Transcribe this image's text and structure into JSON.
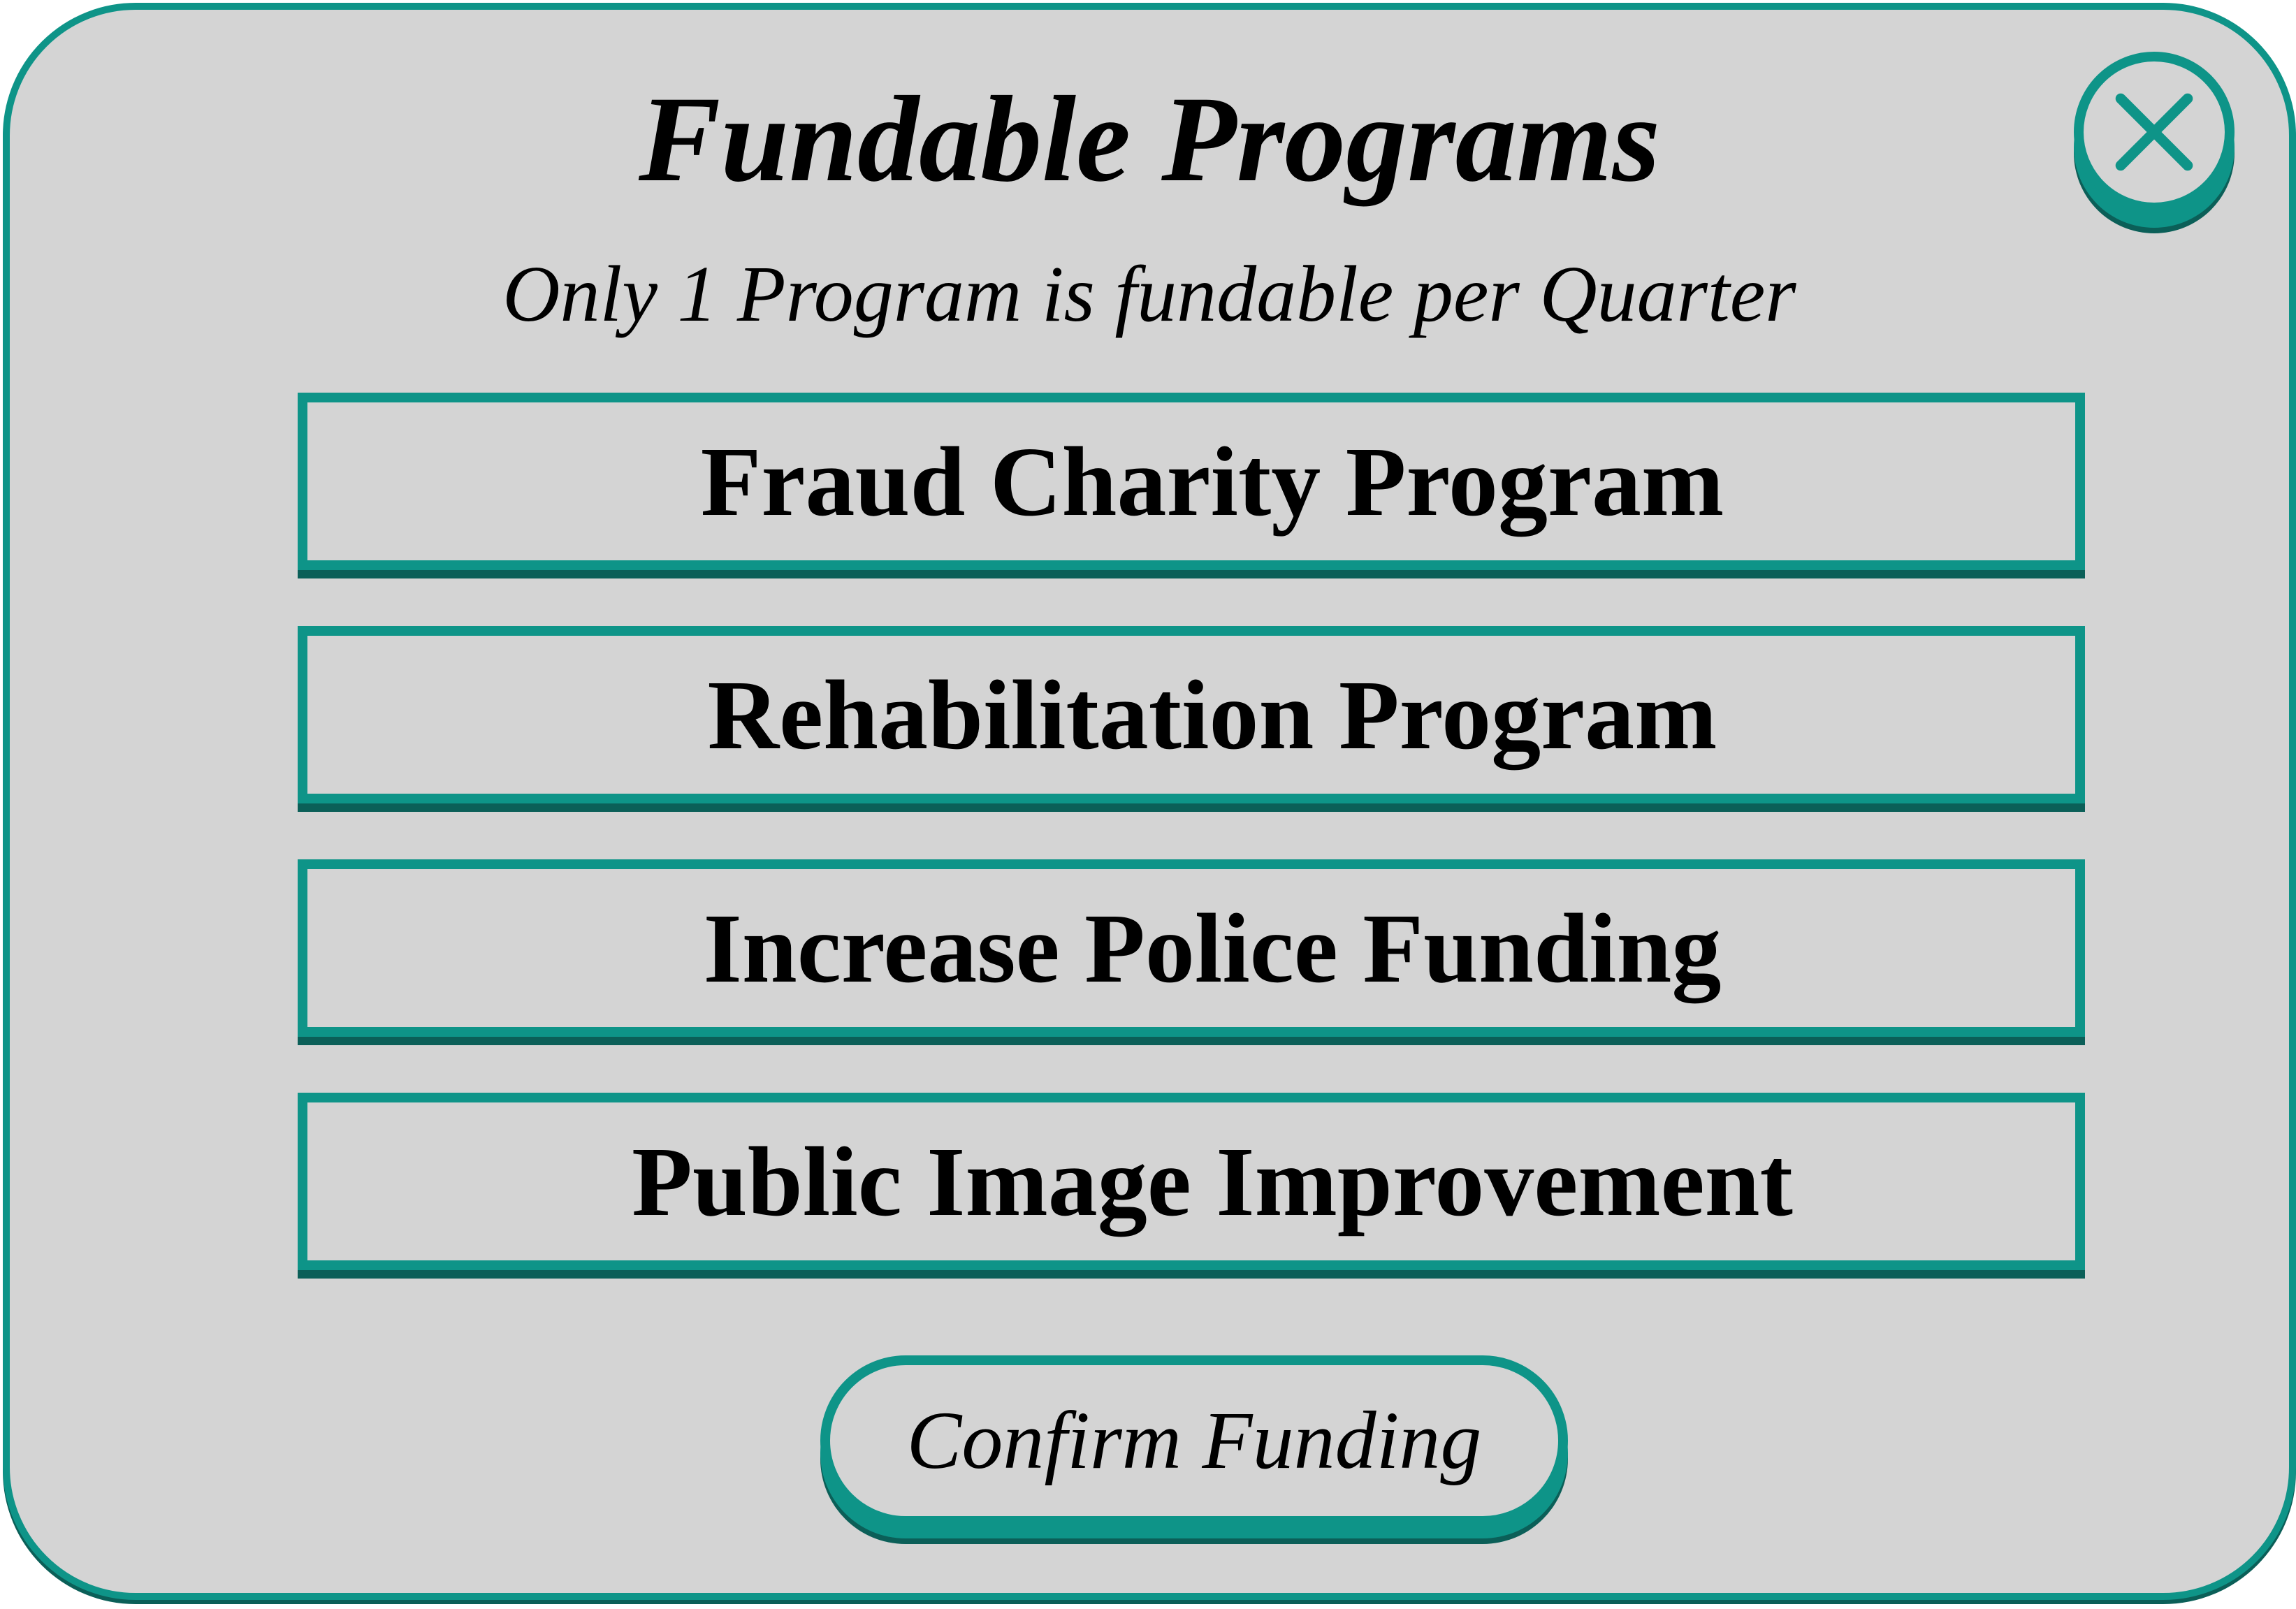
{
  "dialog": {
    "title": "Fundable Programs",
    "subtitle": "Only 1 Program is fundable per Quarter",
    "close_icon": "close-x-icon",
    "programs": [
      {
        "label": "Fraud Charity Program"
      },
      {
        "label": "Rehabilitation Program"
      },
      {
        "label": "Increase Police Funding"
      },
      {
        "label": "Public Image Improvement"
      }
    ],
    "confirm_label": "Confirm Funding"
  },
  "colors": {
    "accent": "#0e9488",
    "accent_dark": "#0b5f58",
    "panel_background": "#d4d4d4",
    "text": "#000000"
  }
}
